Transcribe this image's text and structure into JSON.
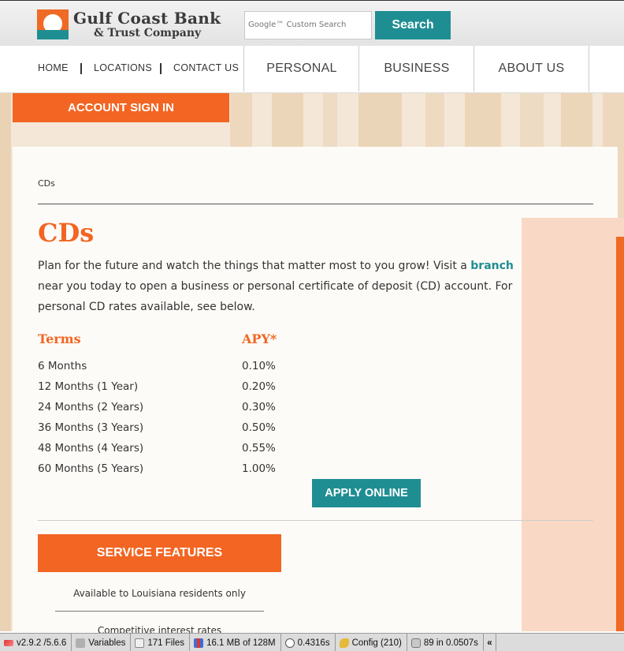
{
  "header": {
    "logo_line1": "Gulf Coast Bank",
    "logo_line2": "& Trust Company",
    "search_placeholder": "Google™ Custom Search",
    "search_button": "Search"
  },
  "nav": {
    "small_links": [
      "HOME",
      "LOCATIONS",
      "CONTACT US"
    ],
    "main_links": [
      "PERSONAL",
      "BUSINESS",
      "ABOUT US"
    ]
  },
  "account_signin": "ACCOUNT SIGN IN",
  "breadcrumb": "CDs",
  "page_title": "CDs",
  "intro": {
    "before_link": "Plan for the future and watch the things that matter most to you grow! Visit a ",
    "link": "branch",
    "after_link": " near you today to open a business or personal certificate of deposit (CD) account.  For personal CD rates available, see below."
  },
  "rates": {
    "header_term": "Terms",
    "header_apy": "APY*",
    "rows": [
      {
        "term": "6 Months",
        "apy": "0.10%"
      },
      {
        "term": "12 Months (1 Year)",
        "apy": "0.20%"
      },
      {
        "term": "24 Months (2 Years)",
        "apy": "0.30%"
      },
      {
        "term": "36 Months (3 Years)",
        "apy": "0.50%"
      },
      {
        "term": "48 Months (4 Years)",
        "apy": "0.55%"
      },
      {
        "term": "60 Months (5 Years)",
        "apy": "1.00%"
      }
    ]
  },
  "apply_button": "APPLY ONLINE",
  "service_features": {
    "title": "SERVICE FEATURES",
    "items": [
      "Available to Louisiana residents only",
      "Competitive interest rates"
    ]
  },
  "debug_toolbar": {
    "version": "v2.9.2 /5.6.6",
    "variables": "Variables",
    "files": "171 Files",
    "memory": "16.1 MB of 128M",
    "time": "0.4316s",
    "config": "Config (210)",
    "queries": "89 in 0.0507s",
    "collapse": "«"
  },
  "colors": {
    "brand_orange": "#f26522",
    "brand_teal": "#1f8e93"
  }
}
